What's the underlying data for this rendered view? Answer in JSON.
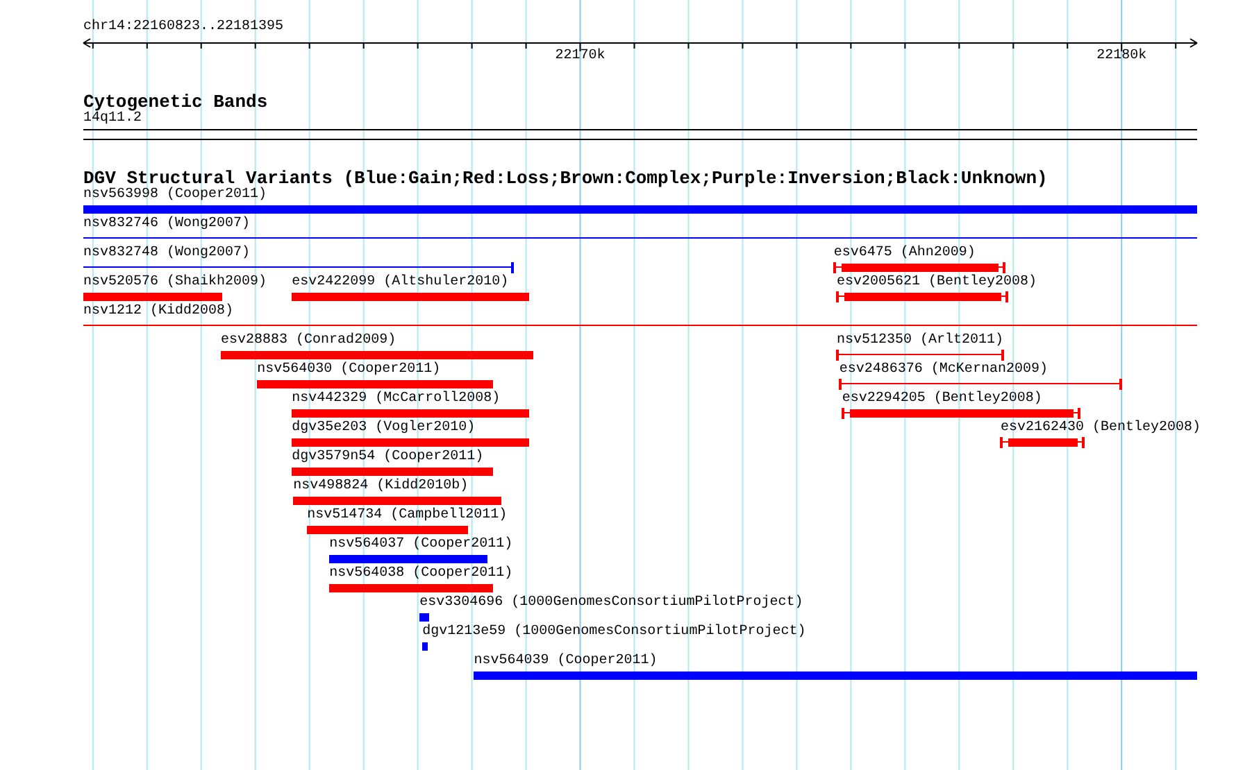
{
  "ruler": {
    "range_label": "chr14:22160823..22181395",
    "major_ticks": [
      "22170k",
      "22180k"
    ]
  },
  "cytogenetic_bands": {
    "title": "Cytogenetic Bands",
    "band": "14q11.2"
  },
  "structural_variants": {
    "title": "DGV Structural Variants (Blue:Gain;Red:Loss;Brown:Complex;Purple:Inversion;Black:Unknown)",
    "features": [
      {
        "label": "nsv563998 (Cooper2011)",
        "color": "#0000ff",
        "kind": "box"
      },
      {
        "label": "nsv832746 (Wong2007)",
        "color": "#0000ff",
        "kind": "line"
      },
      {
        "label": "nsv832748 (Wong2007)",
        "color": "#0000ff",
        "kind": "line"
      },
      {
        "label": "esv6475 (Ahn2009)",
        "color": "#ff0000",
        "kind": "capped"
      },
      {
        "label": "nsv520576 (Shaikh2009)",
        "color": "#ff0000",
        "kind": "box"
      },
      {
        "label": "esv2422099 (Altshuler2010)",
        "color": "#ff0000",
        "kind": "box"
      },
      {
        "label": "esv2005621 (Bentley2008)",
        "color": "#ff0000",
        "kind": "capped"
      },
      {
        "label": "nsv1212 (Kidd2008)",
        "color": "#ff0000",
        "kind": "line"
      },
      {
        "label": "esv28883 (Conrad2009)",
        "color": "#ff0000",
        "kind": "box"
      },
      {
        "label": "nsv512350 (Arlt2011)",
        "color": "#ff0000",
        "kind": "line"
      },
      {
        "label": "nsv564030 (Cooper2011)",
        "color": "#ff0000",
        "kind": "box"
      },
      {
        "label": "esv2486376 (McKernan2009)",
        "color": "#ff0000",
        "kind": "line"
      },
      {
        "label": "nsv442329 (McCarroll2008)",
        "color": "#ff0000",
        "kind": "box"
      },
      {
        "label": "esv2294205 (Bentley2008)",
        "color": "#ff0000",
        "kind": "capped"
      },
      {
        "label": "dgv35e203 (Vogler2010)",
        "color": "#ff0000",
        "kind": "box"
      },
      {
        "label": "esv2162430 (Bentley2008)",
        "color": "#ff0000",
        "kind": "capped"
      },
      {
        "label": "dgv3579n54 (Cooper2011)",
        "color": "#ff0000",
        "kind": "box"
      },
      {
        "label": "nsv498824 (Kidd2010b)",
        "color": "#ff0000",
        "kind": "box"
      },
      {
        "label": "nsv514734 (Campbell2011)",
        "color": "#ff0000",
        "kind": "box"
      },
      {
        "label": "nsv564037 (Cooper2011)",
        "color": "#0000ff",
        "kind": "box"
      },
      {
        "label": "nsv564038 (Cooper2011)",
        "color": "#ff0000",
        "kind": "box"
      },
      {
        "label": "esv3304696 (1000GenomesConsortiumPilotProject)",
        "color": "#0000ff",
        "kind": "box"
      },
      {
        "label": "dgv1213e59 (1000GenomesConsortiumPilotProject)",
        "color": "#0000ff",
        "kind": "box"
      },
      {
        "label": "nsv564039 (Cooper2011)",
        "color": "#0000ff",
        "kind": "box"
      }
    ]
  }
}
